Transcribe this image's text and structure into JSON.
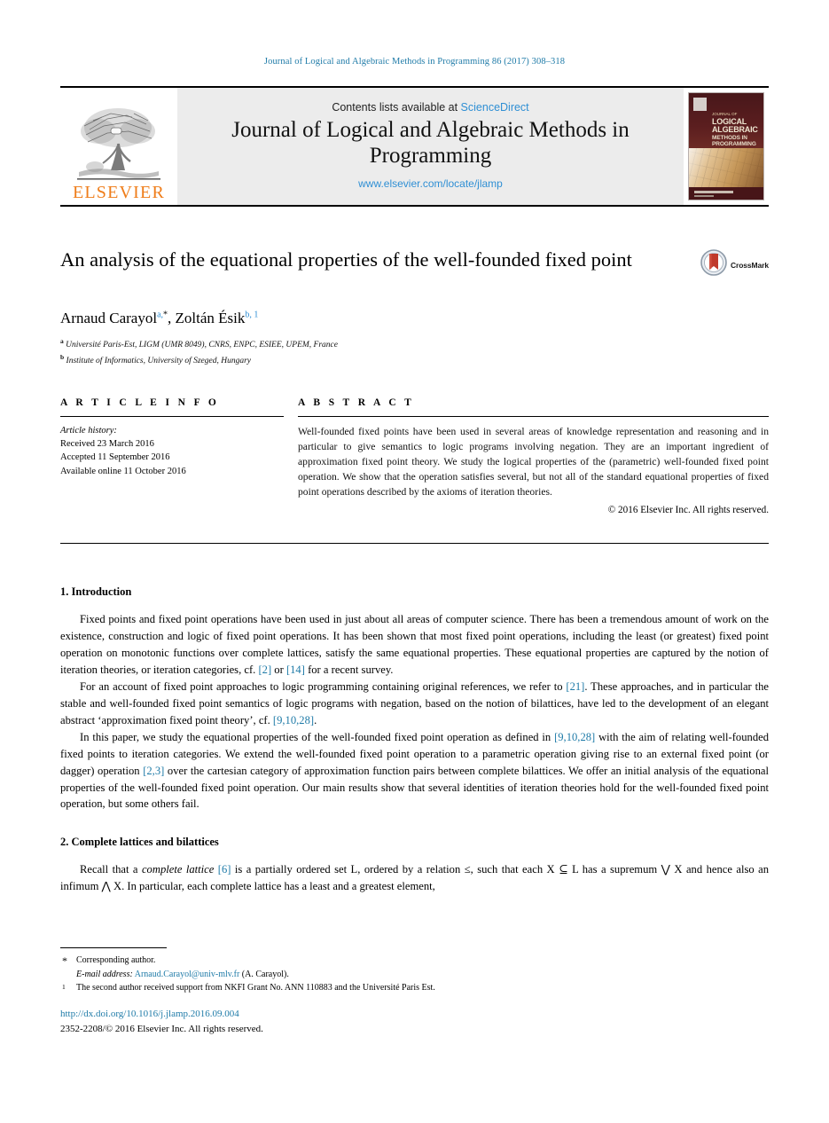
{
  "running_head": "Journal of Logical and Algebraic Methods in Programming 86 (2017) 308–318",
  "masthead": {
    "publisher_name": "ELSEVIER",
    "contents_prefix": "Contents lists available at ",
    "contents_link": "ScienceDirect",
    "journal_title": "Journal of Logical and Algebraic Methods in Programming",
    "journal_url": "www.elsevier.com/locate/jlamp",
    "cover": {
      "kicker": "JOURNAL OF",
      "line1": "LOGICAL",
      "line2": "ALGEBRAIC",
      "line3": "METHODS IN",
      "line4": "PROGRAMMING"
    }
  },
  "article": {
    "title": "An analysis of the equational properties of the well-founded fixed point",
    "crossmark_label": "CrossMark",
    "authors_html": "Arnaud Carayol, Zoltán Ésik",
    "author1_name": "Arnaud Carayol",
    "author1_sup": "a,",
    "author1_star": "*",
    "author2_name": "Zoltán Ésik",
    "author2_sup": "b, 1",
    "affiliation_a_mark": "a",
    "affiliation_a": "Université Paris-Est, LIGM (UMR 8049), CNRS, ENPC, ESIEE, UPEM, France",
    "affiliation_b_mark": "b",
    "affiliation_b": "Institute of Informatics, University of Szeged, Hungary"
  },
  "info": {
    "heading": "A R T I C L E     I N F O",
    "history_label": "Article history:",
    "received": "Received 23 March 2016",
    "accepted": "Accepted 11 September 2016",
    "available": "Available online 11 October 2016"
  },
  "abstract": {
    "heading": "A B S T R A C T",
    "text": "Well-founded fixed points have been used in several areas of knowledge representation and reasoning and in particular to give semantics to logic programs involving negation. They are an important ingredient of approximation fixed point theory. We study the logical properties of the (parametric) well-founded fixed point operation. We show that the operation satisfies several, but not all of the standard equational properties of fixed point operations described by the axioms of iteration theories.",
    "copyright": "© 2016 Elsevier Inc. All rights reserved."
  },
  "sections": {
    "intro_heading": "1. Introduction",
    "intro_p1_a": "Fixed points and fixed point operations have been used in just about all areas of computer science. There has been a tremendous amount of work on the existence, construction and logic of fixed point operations. It has been shown that most fixed point operations, including the least (or greatest) fixed point operation on monotonic functions over complete lattices, satisfy the same equational properties. These equational properties are captured by the notion of iteration theories, or iteration categories, cf. ",
    "intro_p1_ref1": "[2]",
    "intro_p1_b": " or ",
    "intro_p1_ref2": "[14]",
    "intro_p1_c": " for a recent survey.",
    "intro_p2_a": "For an account of fixed point approaches to logic programming containing original references, we refer to ",
    "intro_p2_ref1": "[21]",
    "intro_p2_b": ". These approaches, and in particular the stable and well-founded fixed point semantics of logic programs with negation, based on the notion of bilattices, have led to the development of an elegant abstract ‘approximation fixed point theory’, cf. ",
    "intro_p2_ref2": "[9,10,28]",
    "intro_p2_c": ".",
    "intro_p3_a": "In this paper, we study the equational properties of the well-founded fixed point operation as defined in ",
    "intro_p3_ref1": "[9,10,28]",
    "intro_p3_b": " with the aim of relating well-founded fixed points to iteration categories. We extend the well-founded fixed point operation to a parametric operation giving rise to an external fixed point (or dagger) operation ",
    "intro_p3_ref2": "[2,3]",
    "intro_p3_c": " over the cartesian category of approximation function pairs between complete bilattices. We offer an initial analysis of the equational properties of the well-founded fixed point operation. Our main results show that several identities of iteration theories hold for the well-founded fixed point operation, but some others fail.",
    "lattices_heading": "2. Complete lattices and bilattices",
    "lattices_p1_a": "Recall that a ",
    "lattices_p1_it": "complete lattice",
    "lattices_p1_b": " ",
    "lattices_p1_ref": "[6]",
    "lattices_p1_c": " is a partially ordered set L, ordered by a relation ≤, such that each X ⊆ L has a supremum ⋁ X and hence also an infimum ⋀ X. In particular, each complete lattice has a least and a greatest element,"
  },
  "footnotes": {
    "star_mark": "*",
    "corresponding": "Corresponding author.",
    "email_label": "E-mail address:",
    "email": "Arnaud.Carayol@univ-mlv.fr",
    "email_suffix": "(A. Carayol).",
    "num_mark": "1",
    "note1": "The second author received support from NKFI Grant No. ANN 110883 and the Université Paris Est."
  },
  "footer": {
    "doi": "http://dx.doi.org/10.1016/j.jlamp.2016.09.004",
    "issn": "2352-2208/© 2016 Elsevier Inc. All rights reserved."
  },
  "colors": {
    "link_blue": "#1f7ba8",
    "sciencedirect_blue": "#2f8fd4",
    "elsevier_orange": "#ef7d1a"
  }
}
